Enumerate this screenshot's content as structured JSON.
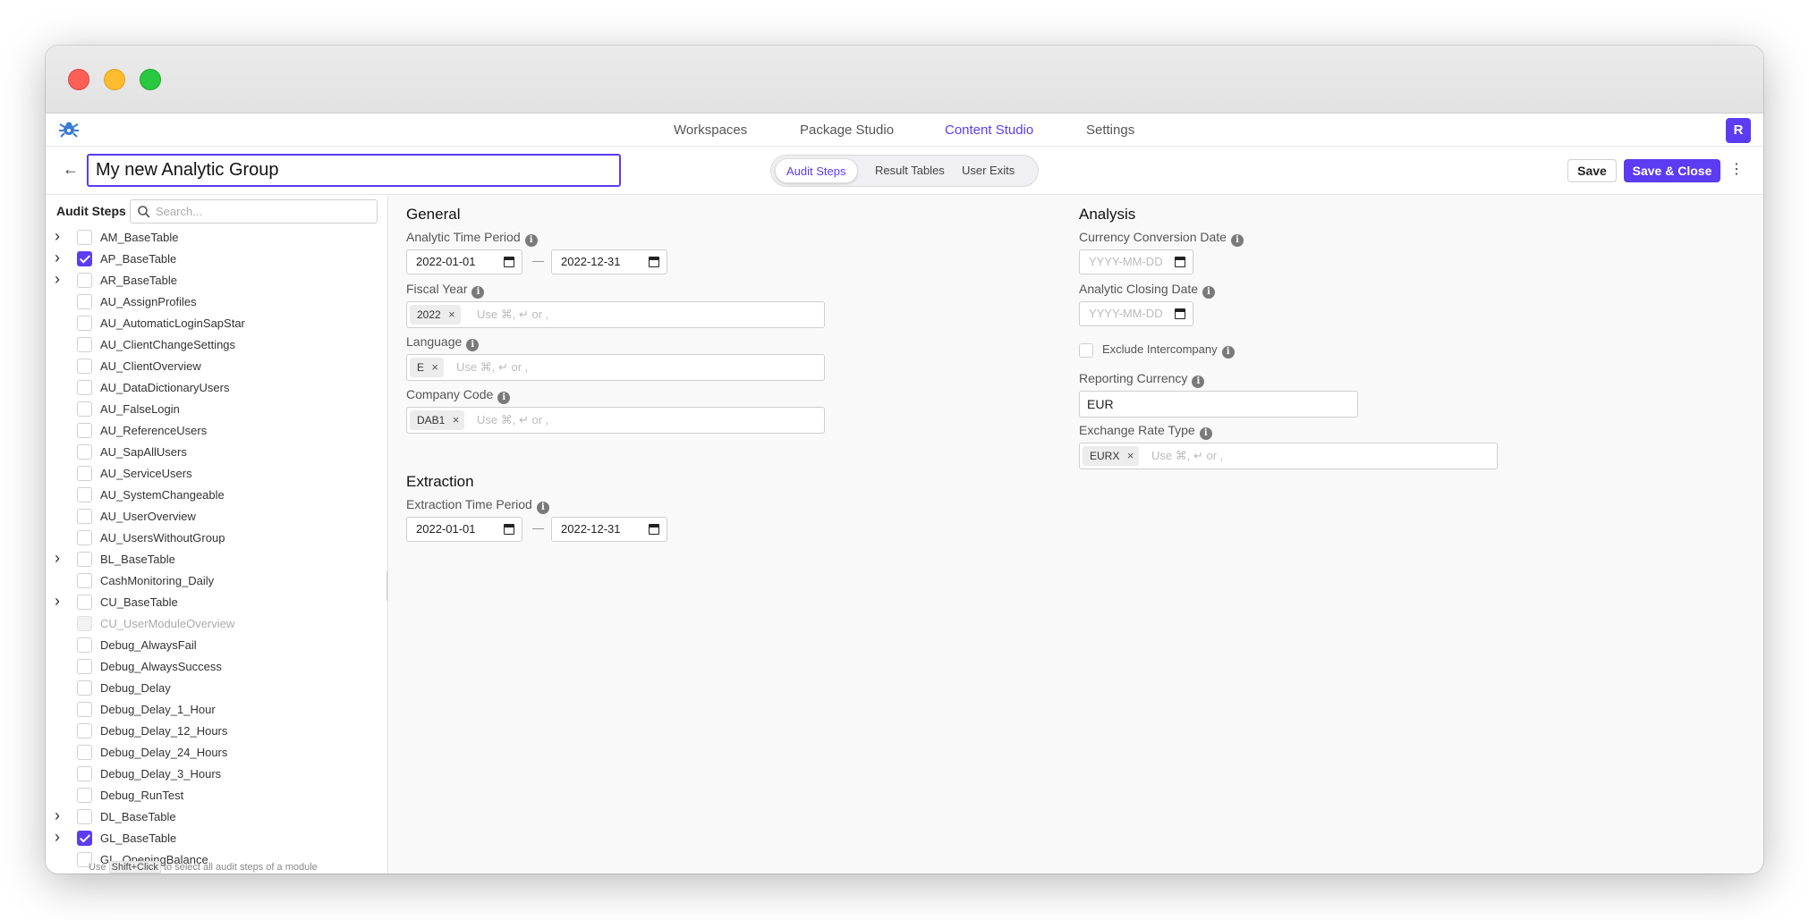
{
  "nav": {
    "items": [
      "Workspaces",
      "Package Studio",
      "Content Studio",
      "Settings"
    ],
    "active": "Content Studio",
    "avatar_initial": "R"
  },
  "header": {
    "group_name": "My new Analytic Group",
    "tabs": [
      "Audit Steps",
      "Result Tables",
      "User Exits"
    ],
    "active_tab": "Audit Steps",
    "save_label": "Save",
    "save_close_label": "Save & Close"
  },
  "sidebar": {
    "title": "Audit Steps",
    "search_placeholder": "Search...",
    "items": [
      {
        "label": "AM_BaseTable",
        "expandable": true,
        "checked": false
      },
      {
        "label": "AP_BaseTable",
        "expandable": true,
        "checked": true
      },
      {
        "label": "AR_BaseTable",
        "expandable": true,
        "checked": false
      },
      {
        "label": "AU_AssignProfiles",
        "expandable": false,
        "checked": false
      },
      {
        "label": "AU_AutomaticLoginSapStar",
        "expandable": false,
        "checked": false
      },
      {
        "label": "AU_ClientChangeSettings",
        "expandable": false,
        "checked": false
      },
      {
        "label": "AU_ClientOverview",
        "expandable": false,
        "checked": false
      },
      {
        "label": "AU_DataDictionaryUsers",
        "expandable": false,
        "checked": false
      },
      {
        "label": "AU_FalseLogin",
        "expandable": false,
        "checked": false
      },
      {
        "label": "AU_ReferenceUsers",
        "expandable": false,
        "checked": false
      },
      {
        "label": "AU_SapAllUsers",
        "expandable": false,
        "checked": false
      },
      {
        "label": "AU_ServiceUsers",
        "expandable": false,
        "checked": false
      },
      {
        "label": "AU_SystemChangeable",
        "expandable": false,
        "checked": false
      },
      {
        "label": "AU_UserOverview",
        "expandable": false,
        "checked": false
      },
      {
        "label": "AU_UsersWithoutGroup",
        "expandable": false,
        "checked": false
      },
      {
        "label": "BL_BaseTable",
        "expandable": true,
        "checked": false
      },
      {
        "label": "CashMonitoring_Daily",
        "expandable": false,
        "checked": false
      },
      {
        "label": "CU_BaseTable",
        "expandable": true,
        "checked": false
      },
      {
        "label": "CU_UserModuleOverview",
        "expandable": false,
        "checked": false,
        "disabled": true
      },
      {
        "label": "Debug_AlwaysFail",
        "expandable": false,
        "checked": false
      },
      {
        "label": "Debug_AlwaysSuccess",
        "expandable": false,
        "checked": false
      },
      {
        "label": "Debug_Delay",
        "expandable": false,
        "checked": false
      },
      {
        "label": "Debug_Delay_1_Hour",
        "expandable": false,
        "checked": false
      },
      {
        "label": "Debug_Delay_12_Hours",
        "expandable": false,
        "checked": false
      },
      {
        "label": "Debug_Delay_24_Hours",
        "expandable": false,
        "checked": false
      },
      {
        "label": "Debug_Delay_3_Hours",
        "expandable": false,
        "checked": false
      },
      {
        "label": "Debug_RunTest",
        "expandable": false,
        "checked": false
      },
      {
        "label": "DL_BaseTable",
        "expandable": true,
        "checked": false
      },
      {
        "label": "GL_BaseTable",
        "expandable": true,
        "checked": true
      },
      {
        "label": "GL_OpeningBalance",
        "expandable": false,
        "checked": false
      }
    ],
    "footer_use": "Use",
    "footer_shortcut": "Shift+Click",
    "footer_rest": "to select all audit steps of a module"
  },
  "general": {
    "title": "General",
    "analytic_period_label": "Analytic Time Period",
    "analytic_start": "2022-01-01",
    "analytic_end": "2022-12-31",
    "fiscal_year_label": "Fiscal Year",
    "fiscal_year_chip": "2022",
    "language_label": "Language",
    "language_chip": "E",
    "company_code_label": "Company Code",
    "company_code_chip": "DAB1",
    "chip_placeholder": "Use ⌘, ↵ or ,"
  },
  "extraction": {
    "title": "Extraction",
    "period_label": "Extraction Time Period",
    "start": "2022-01-01",
    "end": "2022-12-31"
  },
  "analysis": {
    "title": "Analysis",
    "currency_conversion_label": "Currency Conversion Date",
    "currency_conversion_placeholder": "YYYY-MM-DD",
    "closing_date_label": "Analytic Closing Date",
    "closing_date_placeholder": "YYYY-MM-DD",
    "exclude_intercompany_label": "Exclude Intercompany",
    "reporting_currency_label": "Reporting Currency",
    "reporting_currency_value": "EUR",
    "exchange_rate_label": "Exchange Rate Type",
    "exchange_rate_chip": "EURX",
    "chip_placeholder": "Use ⌘, ↵ or ,"
  },
  "colors": {
    "accent": "#5b3cf2"
  }
}
